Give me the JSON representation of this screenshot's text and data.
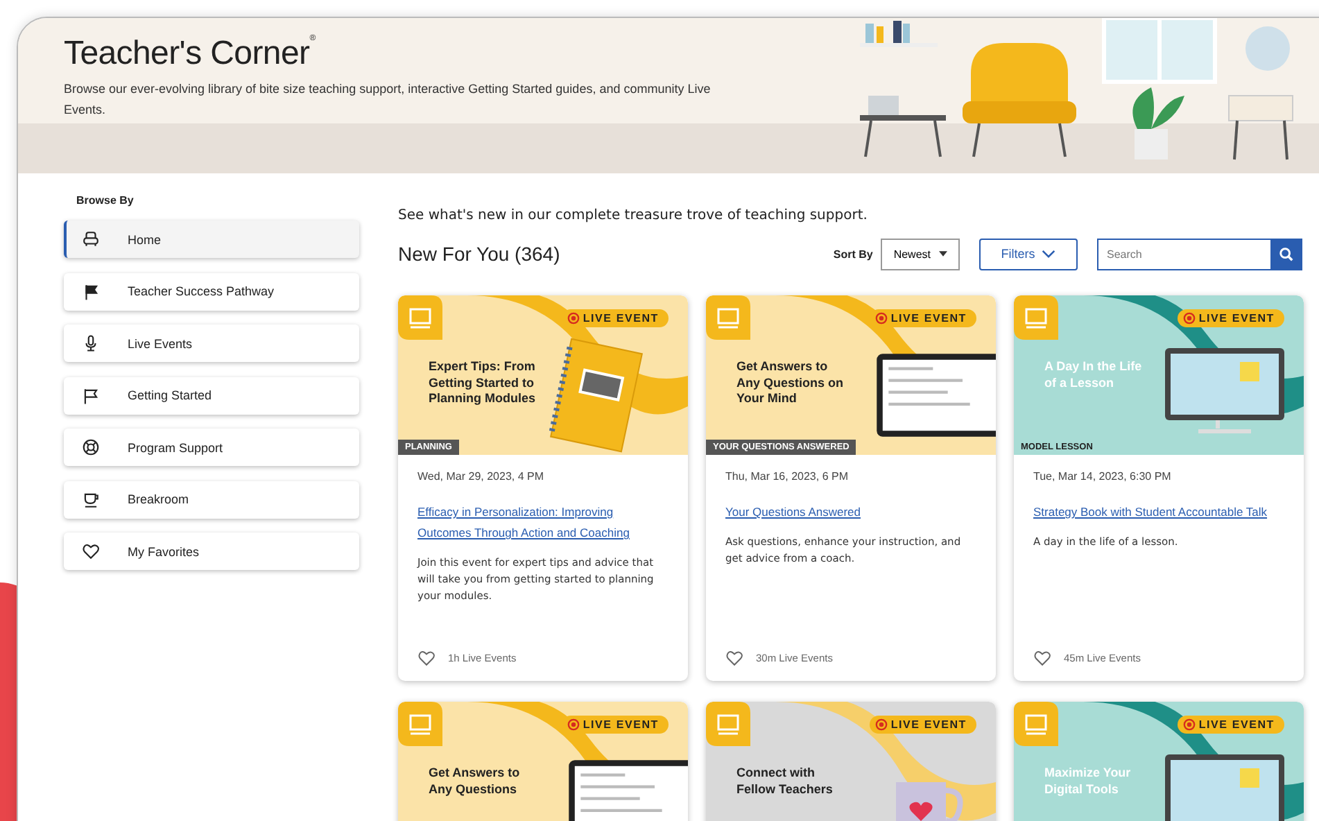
{
  "header": {
    "title": "Teacher's Corner",
    "mark": "®",
    "subtitle": "Browse our ever-evolving library of bite size teaching support, interactive Getting Started guides, and community Live Events."
  },
  "sidebar": {
    "heading": "Browse By",
    "items": [
      {
        "label": "Home",
        "kind": "chair",
        "selected": true
      },
      {
        "label": "Teacher Success Pathway",
        "kind": "pennant",
        "selected": false
      },
      {
        "label": "Live Events",
        "kind": "mic",
        "selected": false
      },
      {
        "label": "Getting Started",
        "kind": "flag",
        "selected": false
      },
      {
        "label": "Program Support",
        "kind": "lifebuoy",
        "selected": false
      },
      {
        "label": "Breakroom",
        "kind": "cup",
        "selected": false
      },
      {
        "label": "My Favorites",
        "kind": "heart",
        "selected": false
      }
    ]
  },
  "main": {
    "intro": "See what's new in our complete treasure trove of teaching support.",
    "heading": "New For You (364)",
    "sort_label": "Sort By",
    "sort_value": "Newest",
    "filters_label": "Filters",
    "search": {
      "placeholder": "Search"
    }
  },
  "cards": [
    {
      "kind": "notebook",
      "badge": "LIVE EVENT",
      "banner_title": "Expert Tips: From Getting Started to Planning Modules",
      "tag": "PLANNING",
      "date": "Wed, Mar 29, 2023, 4 PM",
      "title": "Efficacy in Personalization: Improving Outcomes Through Action and Coaching",
      "description": "Join this event for expert tips and advice that will take you from getting started to planning your modules.",
      "duration": "1h Live Events"
    },
    {
      "kind": "tablet",
      "badge": "LIVE EVENT",
      "banner_title": "Get Answers to Any Questions on Your Mind",
      "tag": "YOUR QUESTIONS ANSWERED",
      "date": "Thu, Mar 16, 2023, 6 PM",
      "title": "Your Questions Answered",
      "description": "Ask questions, enhance your instruction, and get advice from a coach.",
      "duration": "30m Live Events"
    },
    {
      "kind": "monitor",
      "badge": "LIVE EVENT",
      "banner_title": "A Day In the Life of a Lesson",
      "tag": "MODEL LESSON",
      "date": "Tue, Mar 14, 2023, 6:30 PM",
      "title": "Strategy Book with Student Accountable Talk",
      "description": "A day in the life of a lesson.",
      "duration": "45m Live Events"
    },
    {
      "kind": "tablet",
      "badge": "LIVE EVENT",
      "banner_title": "Get Answers to Any Questions"
    },
    {
      "kind": "mug",
      "badge": "LIVE EVENT",
      "banner_title": "Connect with Fellow Teachers"
    },
    {
      "kind": "monitor",
      "badge": "LIVE EVENT",
      "banner_title": "Maximize Your Digital Tools"
    }
  ]
}
